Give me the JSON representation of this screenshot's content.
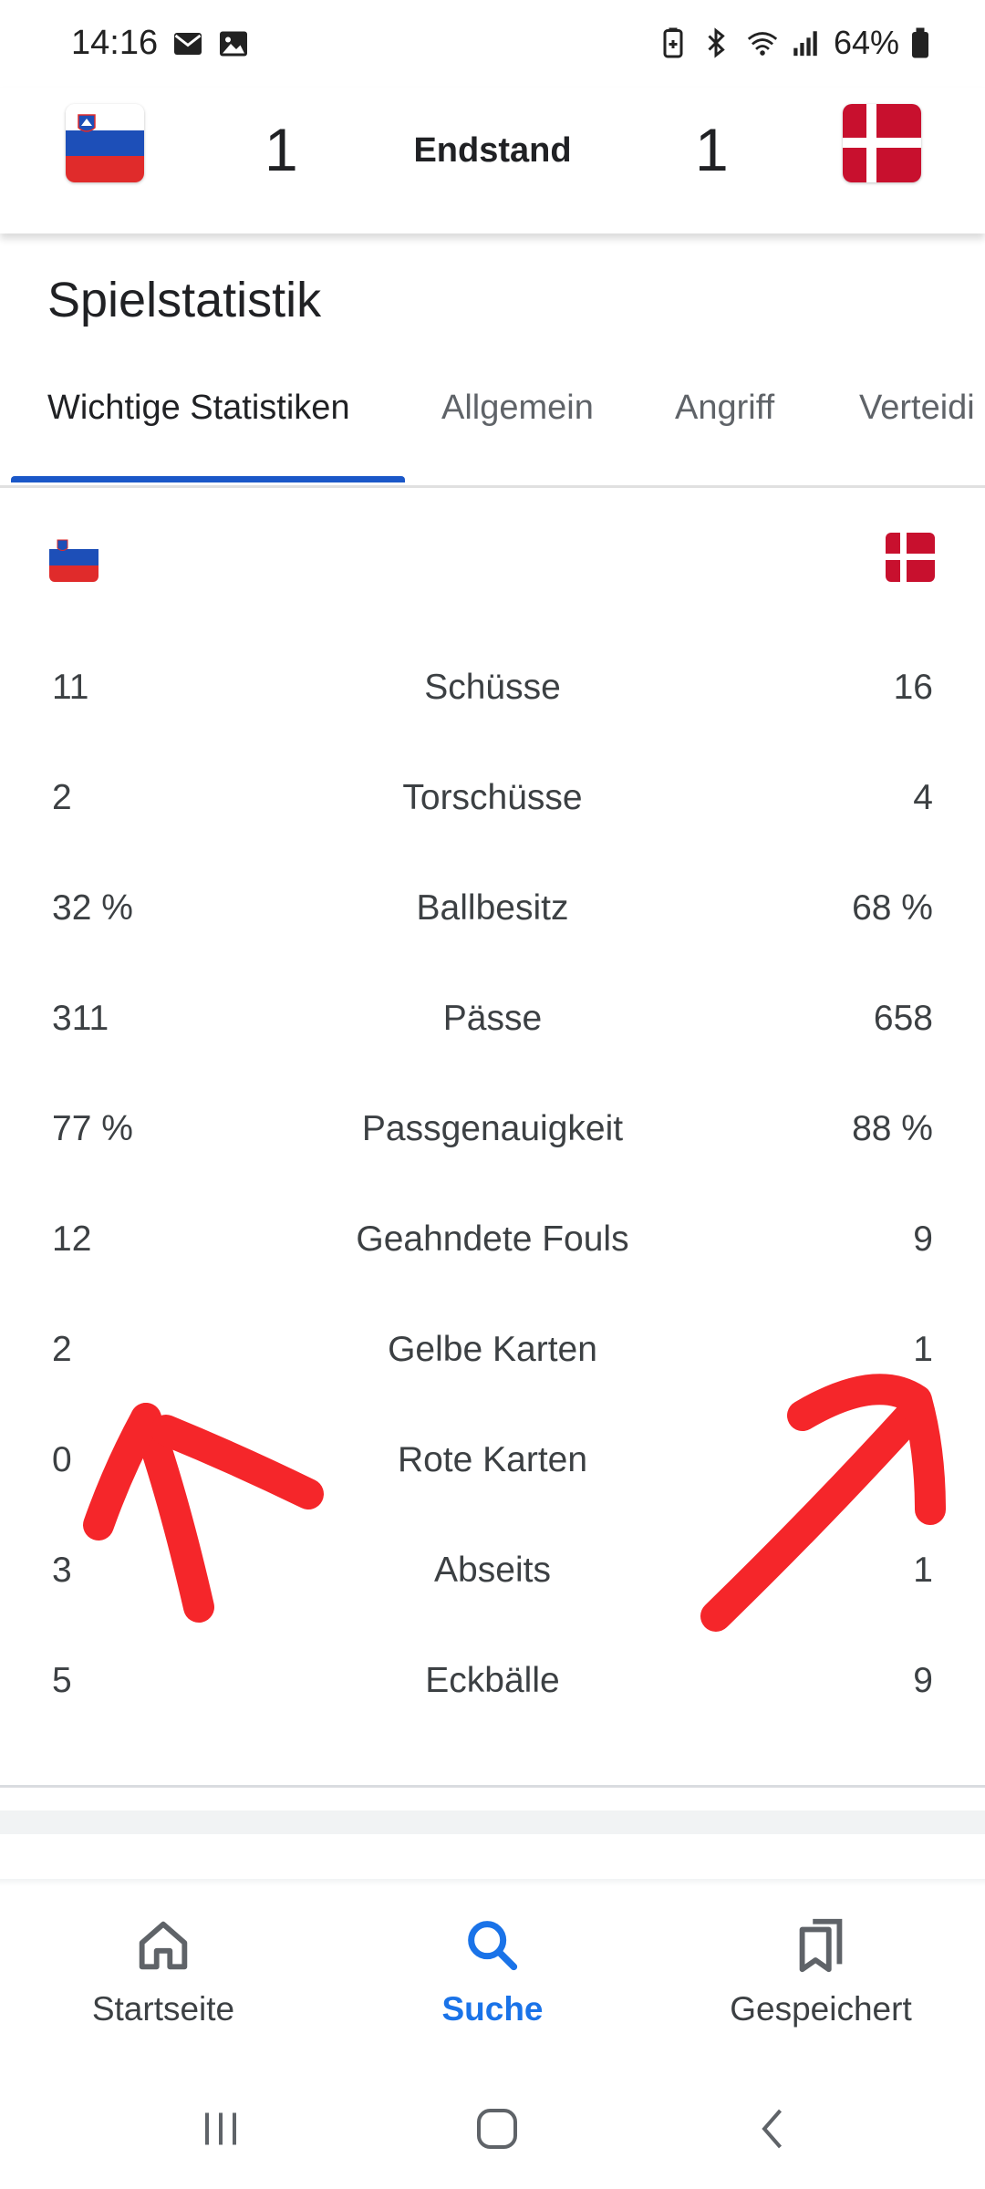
{
  "status_bar": {
    "time": "14:16",
    "battery": "64%"
  },
  "match": {
    "home_score": "1",
    "away_score": "1",
    "status": "Endstand",
    "colors": {
      "slovenia_white": "#ffffff",
      "slovenia_blue": "#1d4fb8",
      "slovenia_red": "#e02b2b",
      "denmark_red": "#c8102e"
    }
  },
  "section": {
    "title": "Spielstatistik",
    "tabs": [
      {
        "label": "Wichtige Statistiken",
        "active": true
      },
      {
        "label": "Allgemein",
        "active": false
      },
      {
        "label": "Angriff",
        "active": false
      },
      {
        "label": "Verteidi",
        "active": false
      }
    ]
  },
  "stats": [
    {
      "home": "11",
      "label": "Schüsse",
      "away": "16"
    },
    {
      "home": "2",
      "label": "Torschüsse",
      "away": "4"
    },
    {
      "home": "32 %",
      "label": "Ballbesitz",
      "away": "68 %"
    },
    {
      "home": "311",
      "label": "Pässe",
      "away": "658"
    },
    {
      "home": "77 %",
      "label": "Passgenauigkeit",
      "away": "88 %"
    },
    {
      "home": "12",
      "label": "Geahndete Fouls",
      "away": "9"
    },
    {
      "home": "2",
      "label": "Gelbe Karten",
      "away": "1"
    },
    {
      "home": "0",
      "label": "Rote Karten",
      "away": "1"
    },
    {
      "home": "3",
      "label": "Abseits",
      "away": "1"
    },
    {
      "home": "5",
      "label": "Eckbälle",
      "away": "9"
    }
  ],
  "bottom_nav": [
    {
      "label": "Startseite",
      "icon": "home-icon",
      "active": false
    },
    {
      "label": "Suche",
      "icon": "search-icon",
      "active": true
    },
    {
      "label": "Gespeichert",
      "icon": "bookmarks-icon",
      "active": false
    }
  ],
  "colors": {
    "accent": "#1a73e8",
    "tab_indicator": "#1a57c8",
    "annotation": "#f5262a"
  }
}
